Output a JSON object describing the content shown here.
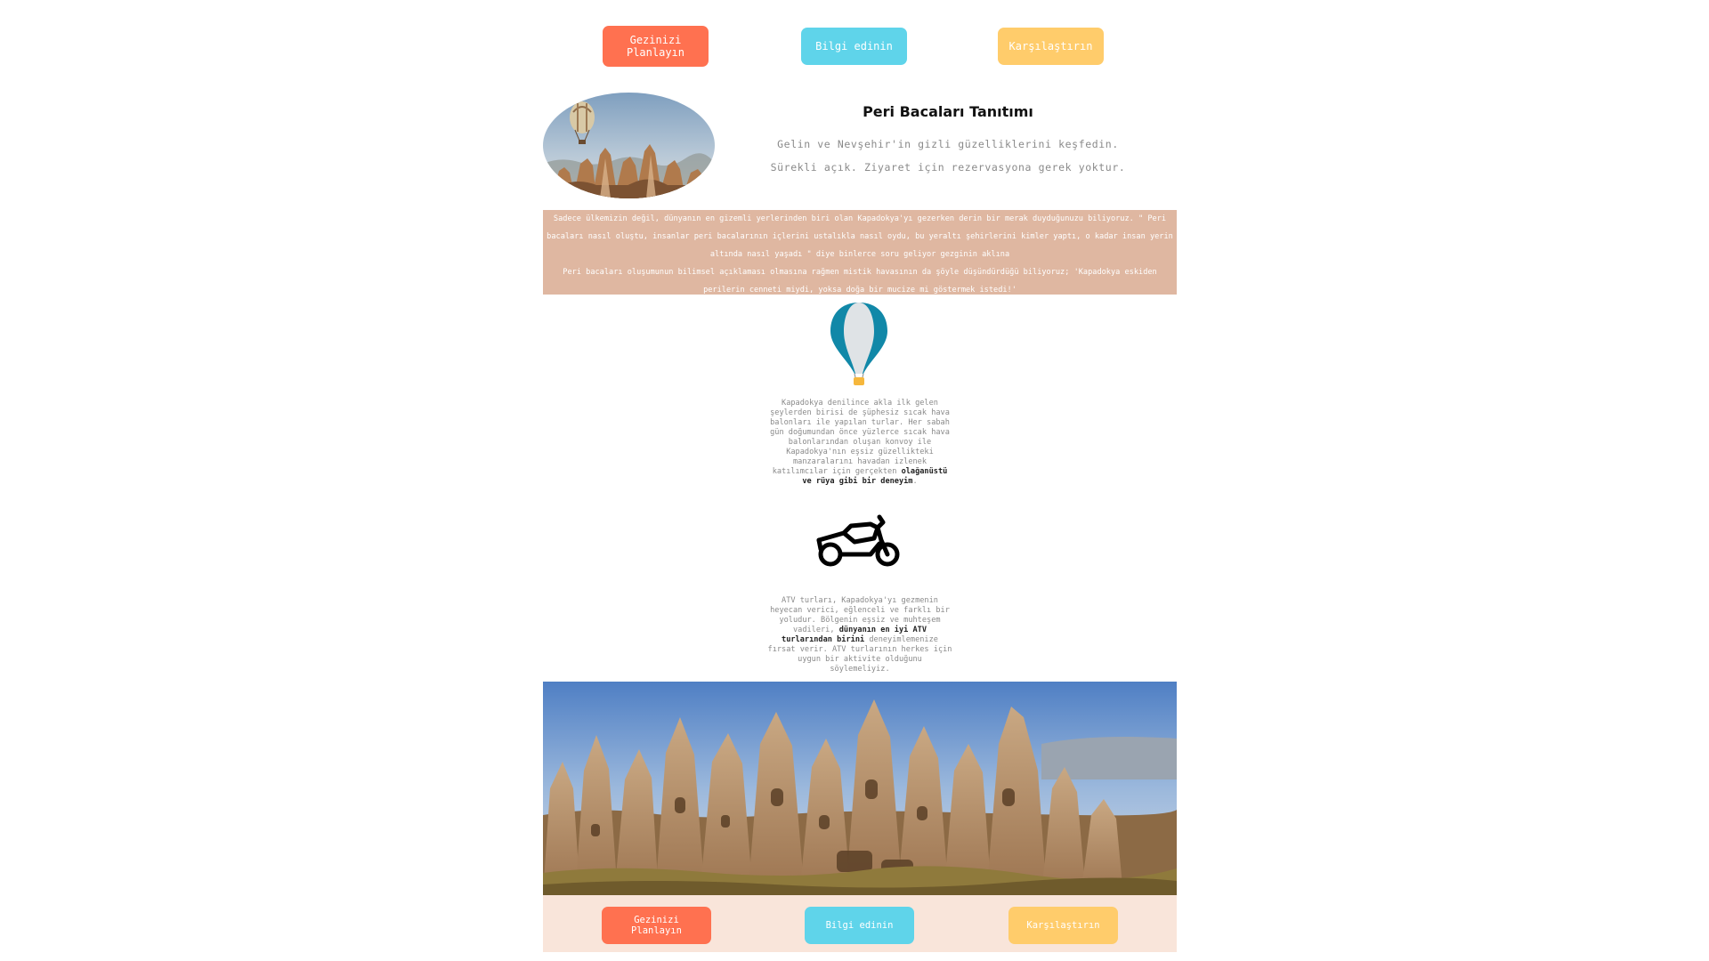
{
  "nav": {
    "plan_label": "Gezinizi Planlayın",
    "info_label": "Bilgi edinin",
    "compare_label": "Karşılaştırın"
  },
  "intro": {
    "title": "Peri Bacaları Tanıtımı",
    "subtitle_1": "Gelin ve Nevşehir'in gizli güzelliklerini keşfedin.",
    "subtitle_2": "Sürekli açık. Ziyaret için rezervasyona gerek yoktur."
  },
  "story": {
    "paragraph_1": "Sadece ülkemizin değil, dünyanın en gizemli yerlerinden biri olan Kapadokya'yı gezerken derin bir merak duyduğunuzu biliyoruz. \" Peri bacaları nasıl oluştu, insanlar peri bacalarının içlerini ustalıkla nasıl oydu, bu yeraltı şehirlerini kimler yaptı, o kadar insan yerin altında nasıl yaşadı \" diye binlerce soru geliyor gezginin aklına",
    "paragraph_2": "Peri bacaları oluşumunun bilimsel açıklaması olmasına rağmen mistik havasının da şöyle düşündürdüğü biliyoruz; 'Kapadokya eskiden perilerin cenneti miydi, yoksa doğa bir mucize mi göstermek istedi!'"
  },
  "balloon": {
    "icon": "hot-air-balloon-icon",
    "text_before": "Kapadokya denilince akla ilk gelen şeylerden birisi de şüphesiz sıcak hava balonları ile yapılan turlar. Her sabah gün doğumundan önce yüzlerce sıcak hava balonlarından oluşan konvoy ile Kapadokya'nın eşsiz güzellikteki manzaralarını havadan izlenek katılımcılar için gerçekten ",
    "highlight": "olağanüstü ve rüya gibi bir deneyim",
    "text_after": "."
  },
  "atv": {
    "icon": "motorbike-icon",
    "text_before": "ATV turları, Kapadokya'yı gezmenin heyecan verici, eğlenceli ve farklı bir yoludur. Bölgenin eşsiz ve muhteşem vadileri, ",
    "highlight": "dünyanın en iyi ATV turlarından birini",
    "text_after": " deneyimlemenize fırsat verir. ATV turlarının herkes için uygun bir aktivite olduğunu söylemeliyiz."
  },
  "colors": {
    "orange": "#ff7150",
    "blue": "#5fd4ea",
    "yellow": "#ffcc6b",
    "intro_band": "#dfb7a1",
    "bottom_band": "#f9e5da"
  }
}
